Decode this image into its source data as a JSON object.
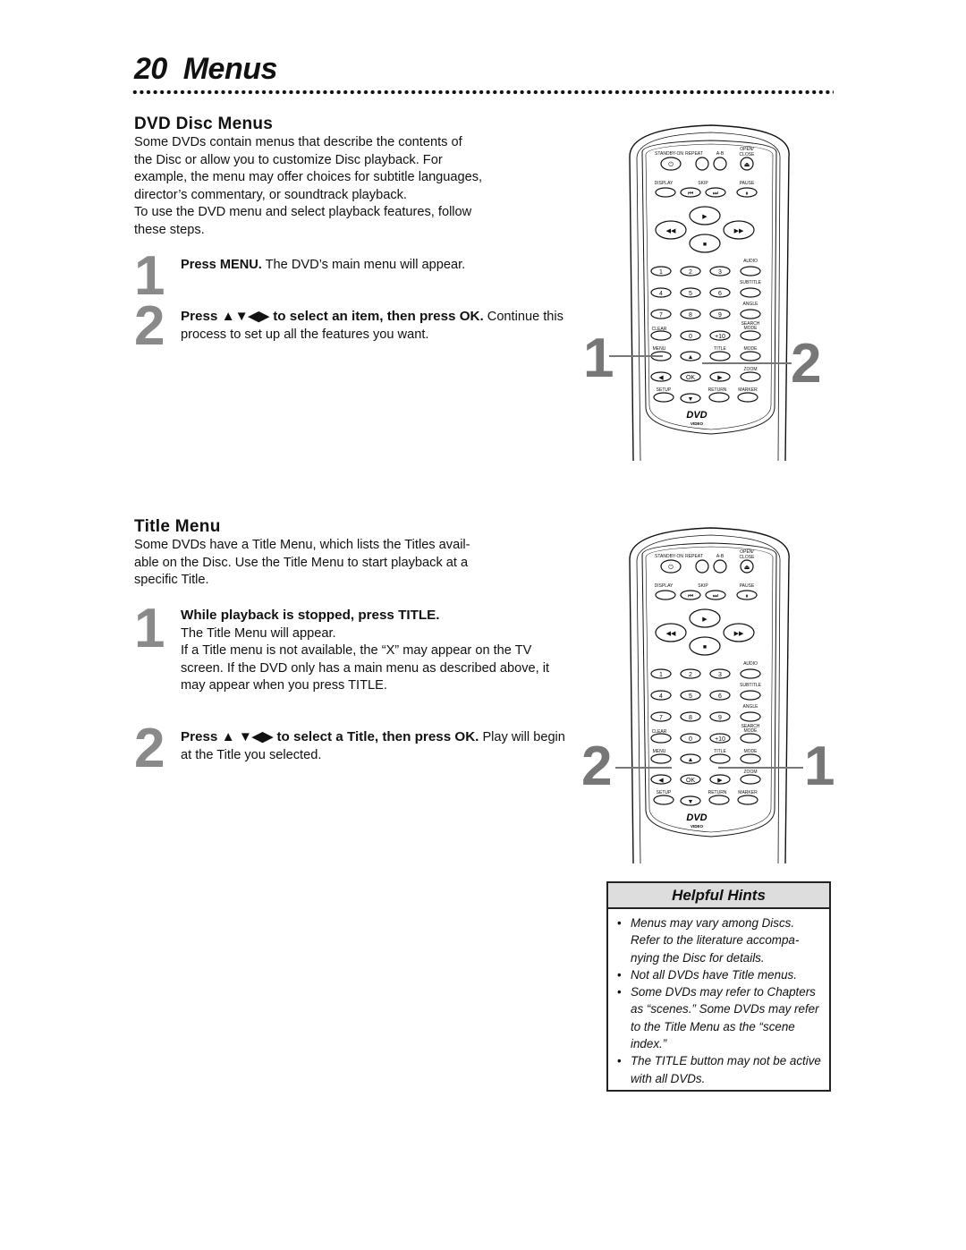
{
  "page": {
    "number": "20",
    "title": "Menus"
  },
  "dvd_disc_menus": {
    "heading": "DVD Disc Menus",
    "intro": [
      "Some DVDs contain menus that describe the contents of",
      "the Disc or allow you to customize Disc playback. For",
      "example, the menu may offer choices for subtitle languages,",
      "director’s commentary, or soundtrack playback.",
      "To use the DVD menu and select playback features, follow",
      "these steps."
    ],
    "steps": [
      {
        "number": "1",
        "bold": "Press MENU.",
        "text": " The DVD’s main menu will appear."
      },
      {
        "number": "2",
        "bold": "Press ▲▼◀▶ to select an item, then press OK.",
        "text": " Continue this process to set up all the features you want."
      }
    ],
    "callouts": [
      "1",
      "2"
    ]
  },
  "title_menu": {
    "heading": "Title Menu",
    "intro": [
      "Some DVDs have a Title Menu, which lists the Titles avail-",
      "able on the Disc. Use the Title Menu to start playback at a",
      "specific Title."
    ],
    "steps": [
      {
        "number": "1",
        "bold": "While playback is stopped, press TITLE.",
        "text": "The Title Menu will appear.",
        "extra": "If a Title menu is not available, the “X” may appear on the TV screen. If the DVD only has a main menu as described above, it may appear when you press TITLE."
      },
      {
        "number": "2",
        "bold": "Press ▲ ▼◀▶ to select a Title, then press OK.",
        "text": " Play will begin at the Title you selected."
      }
    ],
    "callouts": [
      "2",
      "1"
    ]
  },
  "remote": {
    "labels": {
      "standby": "STANDBY-ON",
      "repeat": "REPEAT",
      "ab": "A-B",
      "open_close": "OPEN/ CLOSE",
      "display": "DISPLAY",
      "skip": "SKIP",
      "pause": "PAUSE",
      "audio": "AUDIO",
      "subtitle": "SUBTITLE",
      "angle": "ANGLE",
      "search_mode": "SEARCH MODE",
      "clear": "CLEAR",
      "menu": "MENU",
      "title": "TITLE",
      "mode": "MODE",
      "zoom": "ZOOM",
      "setup": "SETUP",
      "return": "RETURN",
      "marker": "MARKER",
      "ok": "OK",
      "plus10": "+10",
      "logo": "DVD",
      "logo_sub": "VIDEO"
    },
    "digits": [
      "1",
      "2",
      "3",
      "4",
      "5",
      "6",
      "7",
      "8",
      "9",
      "0"
    ]
  },
  "helpful_hints": {
    "heading": "Helpful Hints",
    "items": [
      "Menus may vary among Discs. Refer to the literature accompa-nying the Disc for details.",
      "Not all DVDs have Title menus.",
      "Some DVDs may refer to Chapters as “scenes.” Some DVDs may refer to the Title Menu as the “scene index.”",
      "The TITLE button may not be active with all DVDs."
    ]
  }
}
